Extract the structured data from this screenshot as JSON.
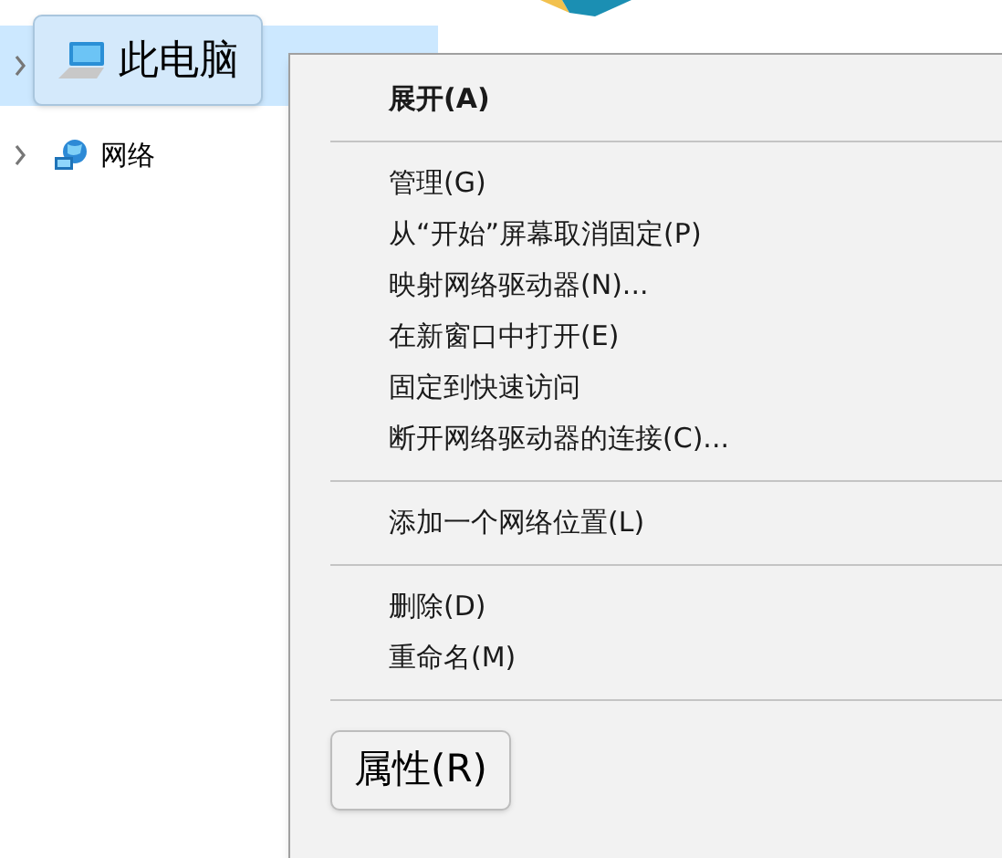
{
  "tree": [
    {
      "label": "此电脑",
      "kind": "computer",
      "selected": true,
      "expanded": false,
      "callout": true
    },
    {
      "label": "网络",
      "kind": "network",
      "selected": false,
      "expanded": false,
      "callout": false
    }
  ],
  "context_menu": {
    "items": [
      {
        "kind": "item",
        "label": "展开(A)",
        "default": true,
        "callout": false
      },
      {
        "kind": "separator"
      },
      {
        "kind": "item",
        "label": "管理(G)",
        "default": false,
        "callout": false
      },
      {
        "kind": "item",
        "label": "从“开始”屏幕取消固定(P)",
        "default": false,
        "callout": false
      },
      {
        "kind": "item",
        "label": "映射网络驱动器(N)...",
        "default": false,
        "callout": false
      },
      {
        "kind": "item",
        "label": "在新窗口中打开(E)",
        "default": false,
        "callout": false
      },
      {
        "kind": "item",
        "label": "固定到快速访问",
        "default": false,
        "callout": false
      },
      {
        "kind": "item",
        "label": "断开网络驱动器的连接(C)...",
        "default": false,
        "callout": false
      },
      {
        "kind": "separator"
      },
      {
        "kind": "item",
        "label": "添加一个网络位置(L)",
        "default": false,
        "callout": false
      },
      {
        "kind": "separator"
      },
      {
        "kind": "item",
        "label": "删除(D)",
        "default": false,
        "callout": false
      },
      {
        "kind": "item",
        "label": "重命名(M)",
        "default": false,
        "callout": false
      },
      {
        "kind": "separator"
      },
      {
        "kind": "item",
        "label": "属性(R)",
        "default": false,
        "callout": true
      }
    ]
  }
}
